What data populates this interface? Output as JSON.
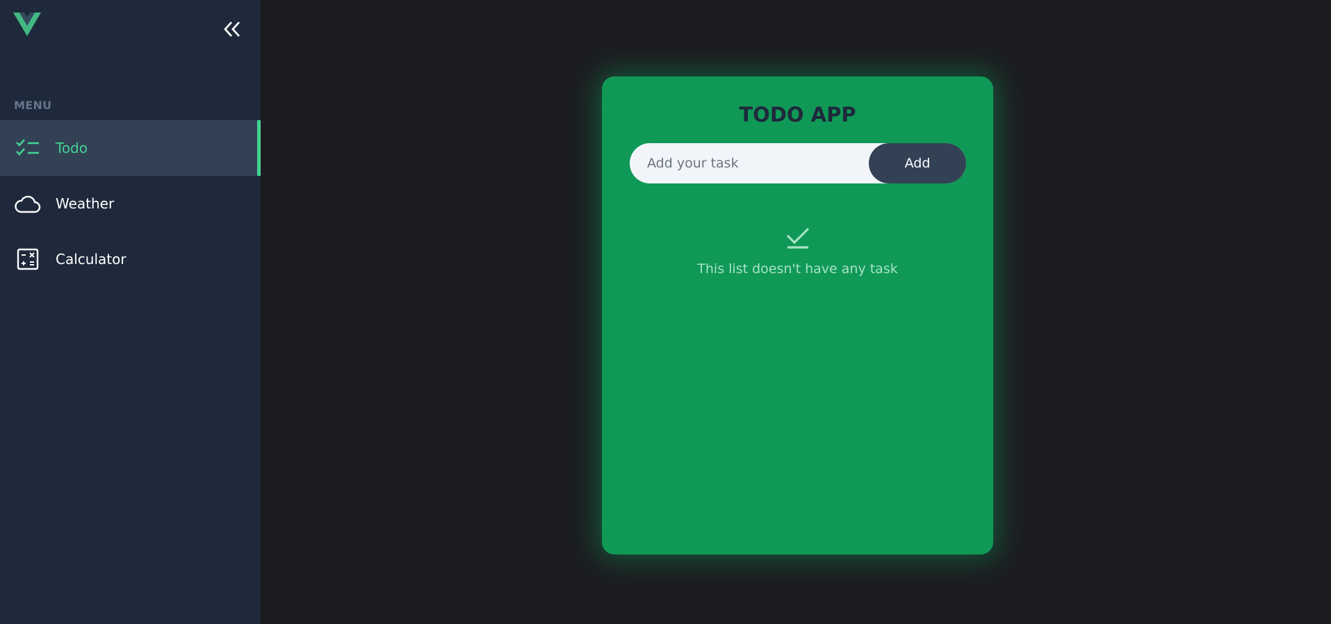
{
  "sidebar": {
    "menu_label": "MENU",
    "items": [
      {
        "label": "Todo",
        "icon": "checklist-icon",
        "active": true
      },
      {
        "label": "Weather",
        "icon": "cloud-icon",
        "active": false
      },
      {
        "label": "Calculator",
        "icon": "calculator-icon",
        "active": false
      }
    ]
  },
  "todo": {
    "title": "TODO APP",
    "input_placeholder": "Add your task",
    "input_value": "",
    "add_label": "Add",
    "empty_message": "This list doesn't have any task"
  },
  "colors": {
    "accent": "#42d392",
    "card": "#109956",
    "sidebar": "#1e293b",
    "sidebar_active": "#334155",
    "background": "#1c1c20"
  }
}
